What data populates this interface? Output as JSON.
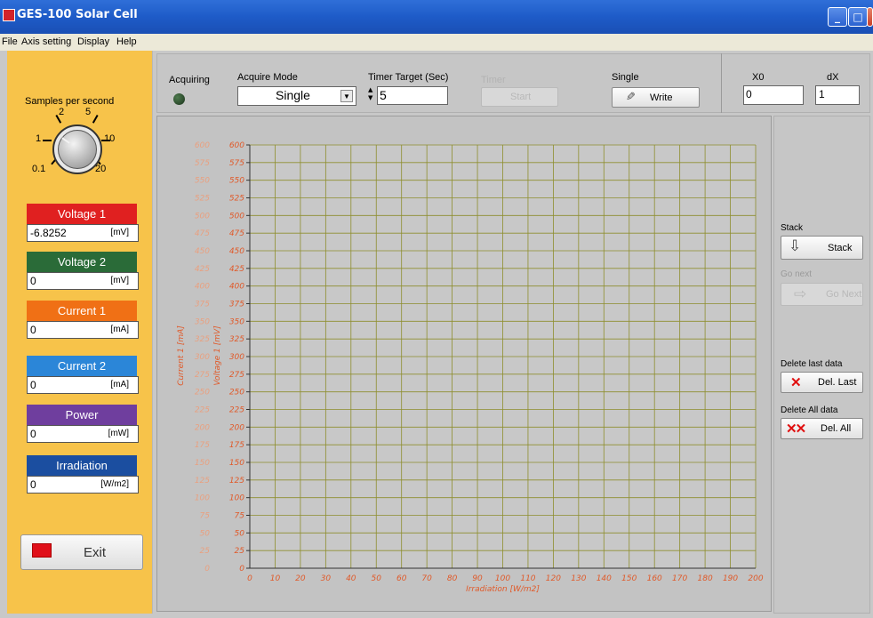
{
  "window": {
    "title": "GES-100 Solar Cell",
    "buttons": [
      "_",
      "□",
      "X"
    ]
  },
  "menu": [
    "File",
    "Axis setting",
    "Display",
    "Help"
  ],
  "samples": {
    "label": "Samples per second",
    "dial_labels": [
      "2",
      "5",
      "1",
      "10",
      "0.1",
      "20"
    ]
  },
  "meters": [
    {
      "name": "Voltage 1",
      "value": "-6.8252",
      "unit": "[mV]",
      "color": "#e02020"
    },
    {
      "name": "Voltage 2",
      "value": "0",
      "unit": "[mV]",
      "color": "#2a6b38"
    },
    {
      "name": "Current 1",
      "value": "0",
      "unit": "[mA]",
      "color": "#f07015"
    },
    {
      "name": "Current 2",
      "value": "0",
      "unit": "[mA]",
      "color": "#2b86d8"
    },
    {
      "name": "Power",
      "value": "0",
      "unit": "[mW]",
      "color": "#6f3e9e"
    },
    {
      "name": "Irradiation",
      "value": "0",
      "unit": "[W/m2]",
      "color": "#1b4ea0"
    }
  ],
  "exit": {
    "label": "Exit"
  },
  "toolbar": {
    "acquiring_label": "Acquiring",
    "acquire_mode_label": "Acquire Mode",
    "acquire_mode_value": "Single",
    "timer_target_label": "Timer Target (Sec)",
    "timer_target_value": "5",
    "timer_label": "Timer",
    "start_label": "Start",
    "single_label": "Single",
    "write_label": "Write",
    "x0_label": "X0",
    "x0_value": "0",
    "dx_label": "dX",
    "dx_value": "1"
  },
  "actions": {
    "stack_label": "Stack",
    "stack_button": "Stack",
    "gonext_label": "Go next",
    "gonext_button": "Go Next",
    "dellast_label": "Delete last data",
    "dellast_button": "Del. Last",
    "delall_label": "Delete All data",
    "delall_button": "Del. All"
  },
  "chart_data": {
    "type": "line",
    "xlabel": "Irradiation [W/m2]",
    "y_labels": [
      "Current 1 [mA]",
      "Voltage 1 [mV]"
    ],
    "xlim": [
      0,
      200
    ],
    "ylim": [
      0,
      600
    ],
    "x_ticks": [
      0,
      10,
      20,
      30,
      40,
      50,
      60,
      70,
      80,
      90,
      100,
      110,
      120,
      130,
      140,
      150,
      160,
      170,
      180,
      190,
      200
    ],
    "y_ticks": [
      0,
      25,
      50,
      75,
      100,
      125,
      150,
      175,
      200,
      225,
      250,
      275,
      300,
      325,
      350,
      375,
      400,
      425,
      450,
      475,
      500,
      525,
      550,
      575,
      600
    ],
    "grid": true,
    "grid_color": "#8e8e2e",
    "axis_color": "#e05a2a",
    "series": []
  }
}
